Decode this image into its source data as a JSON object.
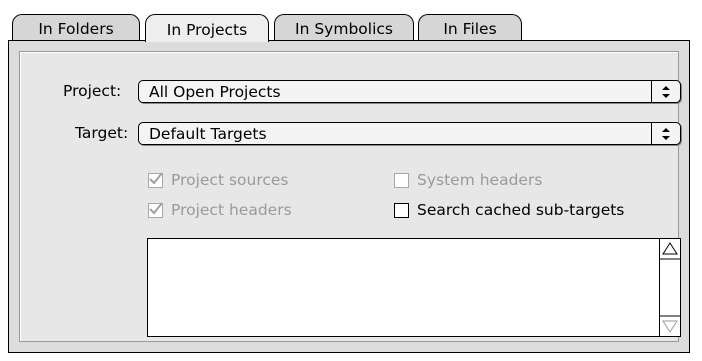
{
  "tabs": [
    {
      "label": "In Folders",
      "active": false
    },
    {
      "label": "In Projects",
      "active": true
    },
    {
      "label": "In Symbolics",
      "active": false
    },
    {
      "label": "In Files",
      "active": false
    }
  ],
  "project": {
    "label": "Project:",
    "value": "All Open Projects"
  },
  "target": {
    "label": "Target:",
    "value": "Default Targets"
  },
  "options": {
    "project_sources": {
      "label": "Project sources",
      "checked": true,
      "enabled": false
    },
    "project_headers": {
      "label": "Project headers",
      "checked": true,
      "enabled": false
    },
    "system_headers": {
      "label": "System headers",
      "checked": false,
      "enabled": false
    },
    "search_cached": {
      "label": "Search cached sub-targets",
      "checked": false,
      "enabled": true
    }
  },
  "colors": {
    "panel": "#dcdcdc",
    "tab_inactive": "#d6d6d6",
    "disabled_text": "#9a9a9a"
  },
  "icons": [
    "popup-arrows-icon",
    "checkmark-icon",
    "scroll-up-arrow-icon",
    "scroll-down-arrow-icon"
  ]
}
